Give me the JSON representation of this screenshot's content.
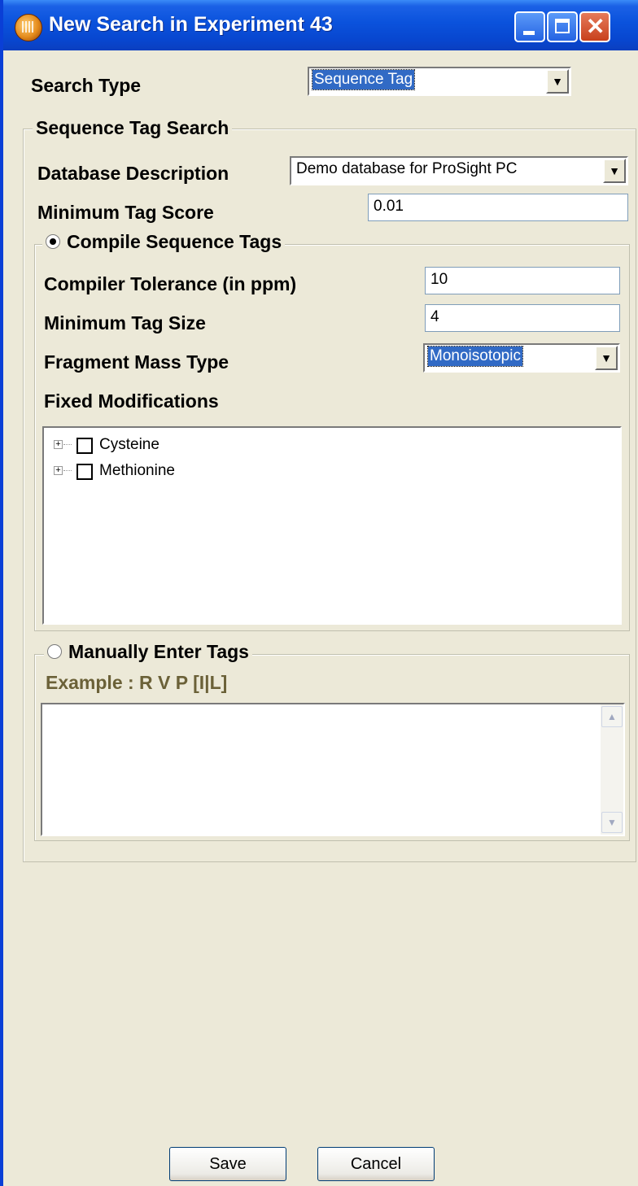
{
  "window": {
    "title": "New Search in Experiment 43",
    "icon": "app-logo-icon",
    "controls": [
      "minimize-icon",
      "maximize-icon",
      "close-icon"
    ]
  },
  "search_type": {
    "label": "Search Type",
    "value": "Sequence Tag"
  },
  "sequence_tag_group": {
    "legend": "Sequence Tag Search",
    "database_label": "Database Description",
    "database_value": "Demo database for ProSight PC",
    "min_tag_score_label": "Minimum Tag Score",
    "min_tag_score_value": "0.01"
  },
  "compile_group": {
    "legend": "Compile Sequence Tags",
    "selected": true,
    "tolerance_label": "Compiler Tolerance (in ppm)",
    "tolerance_value": "10",
    "min_tag_size_label": "Minimum Tag Size",
    "min_tag_size_value": "4",
    "mass_type_label": "Fragment Mass Type",
    "mass_type_value": "Monoisotopic",
    "fixed_mods_label": "Fixed Modifications",
    "fixed_mods": [
      {
        "label": "Cysteine",
        "checked": false
      },
      {
        "label": "Methionine",
        "checked": false
      }
    ]
  },
  "manual_group": {
    "legend": "Manually Enter Tags",
    "selected": false,
    "example": "Example : R V P [I|L]",
    "text": ""
  },
  "buttons": {
    "save": "Save",
    "cancel": "Cancel"
  },
  "colors": {
    "titlebar": "#0a52dc",
    "face": "#ece9d8",
    "selection": "#316ac5",
    "example_text": "#6b6138"
  }
}
